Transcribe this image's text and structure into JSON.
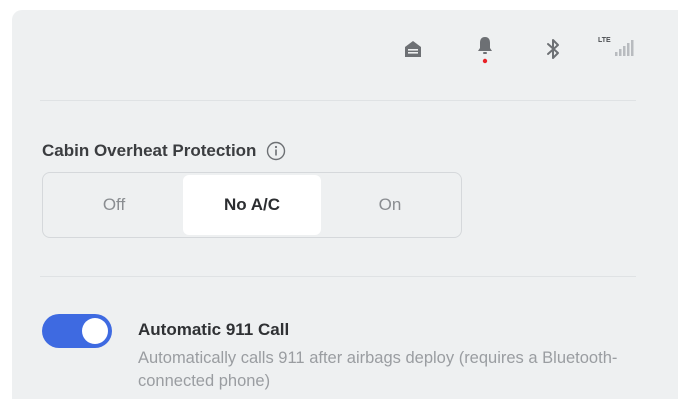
{
  "status_bar": {
    "icons": [
      "garage-icon",
      "bell-icon",
      "bluetooth-icon",
      "lte-signal-icon"
    ],
    "lte_label": "LTE",
    "notification_dot_color": "#e82127"
  },
  "cabin_overheat": {
    "title": "Cabin Overheat Protection",
    "options": [
      "Off",
      "No A/C",
      "On"
    ],
    "selected": "No A/C"
  },
  "automatic_911": {
    "title": "Automatic 911 Call",
    "description": "Automatically calls 911 after airbags deploy (requires a Bluetooth-connected phone)",
    "enabled": true
  },
  "colors": {
    "accent": "#3e6ae1",
    "panel_bg": "#eef0f1"
  }
}
